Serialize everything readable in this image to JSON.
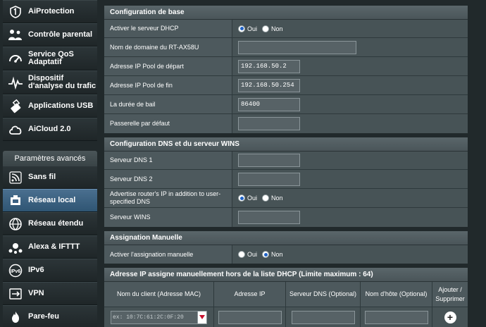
{
  "sidebar": {
    "items_top": [
      {
        "label": "AiProtection",
        "icon": "shield-icon"
      },
      {
        "label": "Contrôle parental",
        "icon": "parental-icon"
      },
      {
        "label": "Service QoS Adaptatif",
        "icon": "qos-gauge-icon"
      },
      {
        "label": "Dispositif d'analyse du trafic",
        "icon": "traffic-analyzer-icon"
      },
      {
        "label": "Applications USB",
        "icon": "usb-icon"
      },
      {
        "label": "AiCloud 2.0",
        "icon": "cloud-icon"
      }
    ],
    "advanced_header": "Paramètres avancés",
    "items_advanced": [
      {
        "label": "Sans fil",
        "icon": "wifi-icon"
      },
      {
        "label": "Réseau local",
        "icon": "lan-icon",
        "active": true
      },
      {
        "label": "Réseau étendu",
        "icon": "wan-globe-icon"
      },
      {
        "label": "Alexa & IFTTT",
        "icon": "alexa-icon"
      },
      {
        "label": "IPv6",
        "icon": "ipv6-icon"
      },
      {
        "label": "VPN",
        "icon": "vpn-icon"
      },
      {
        "label": "Pare-feu",
        "icon": "firewall-icon"
      }
    ]
  },
  "basic": {
    "title": "Configuration de base",
    "dhcp_label": "Activer le serveur DHCP",
    "dhcp_yes": "Oui",
    "dhcp_no": "Non",
    "domain_label": "Nom de domaine du RT-AX58U",
    "domain_value": "",
    "pool_start_label": "Adresse IP Pool de départ",
    "pool_start_value": "192.168.50.2",
    "pool_end_label": "Adresse IP Pool de fin",
    "pool_end_value": "192.168.50.254",
    "lease_label": "La durée de bail",
    "lease_value": "86400",
    "gateway_label": "Passerelle par défaut",
    "gateway_value": ""
  },
  "dns": {
    "title": "Configuration DNS et du serveur WINS",
    "dns1_label": "Serveur DNS 1",
    "dns2_label": "Serveur DNS 2",
    "advertise_label": "Advertise router's IP in addition to user-specified DNS",
    "advertise_yes": "Oui",
    "advertise_no": "Non",
    "wins_label": "Serveur WINS"
  },
  "manual": {
    "title": "Assignation Manuelle",
    "enable_label": "Activer l'assignation manuelle",
    "enable_yes": "Oui",
    "enable_no": "Non"
  },
  "list": {
    "title": "Adresse IP assigne manuellement hors de la liste DHCP (Limite maximum : 64)",
    "col_client": "Nom du client (Adresse MAC)",
    "col_ip": "Adresse IP",
    "col_dns": "Serveur DNS (Optional)",
    "col_host": "Nom d'hôte (Optional)",
    "col_action_1": "Ajouter /",
    "col_action_2": "Supprimer",
    "mac_placeholder": "ex: 10:7C:61:2C:0F:20"
  },
  "colors": {
    "background": "#21292b",
    "panel": "#4d595d",
    "active_item": "#3d6283",
    "radio_checked": "#1f63c7",
    "dropdown_arrow": "#c8102e"
  }
}
